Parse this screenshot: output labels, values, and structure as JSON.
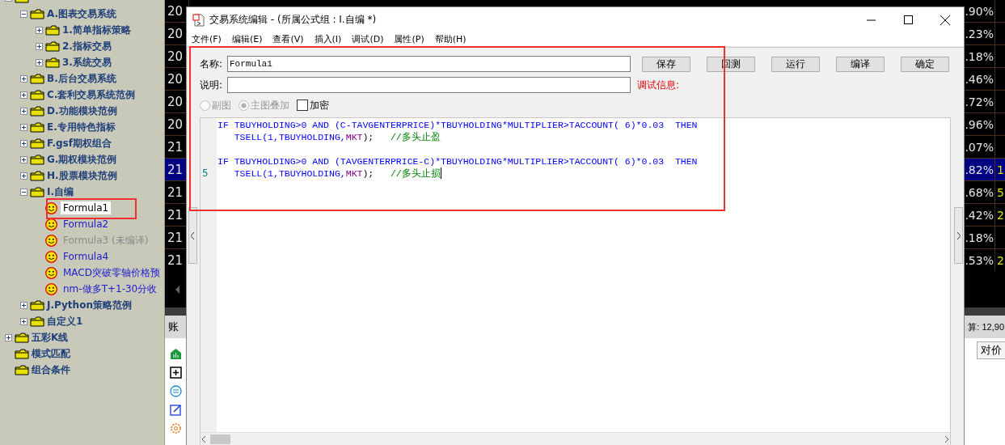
{
  "tree": {
    "items": [
      {
        "kind": "folder",
        "expanded": true,
        "children": [
          {
            "kind": "folder",
            "label": "A.图表交易系统",
            "expanded": true,
            "children": [
              {
                "kind": "folder",
                "label": "1.简单指标策略",
                "expanded": false
              },
              {
                "kind": "folder",
                "label": "2.指标交易",
                "expanded": false
              },
              {
                "kind": "folder",
                "label": "3.系统交易",
                "expanded": false
              }
            ]
          },
          {
            "kind": "folder",
            "label": "B.后台交易系统",
            "expanded": false
          },
          {
            "kind": "folder",
            "label": "C.套利交易系统范例",
            "expanded": false
          },
          {
            "kind": "folder",
            "label": "D.功能模块范例",
            "expanded": false
          },
          {
            "kind": "folder",
            "label": "E.专用特色指标",
            "expanded": false
          },
          {
            "kind": "folder",
            "label": "F.gsf期权组合",
            "expanded": false
          },
          {
            "kind": "folder",
            "label": "G.期权模块范例",
            "expanded": false
          },
          {
            "kind": "folder",
            "label": "H.股票模块范例",
            "expanded": false
          },
          {
            "kind": "folder",
            "label": "I.自编",
            "expanded": true,
            "children": [
              {
                "kind": "formula",
                "label": "Formula1",
                "selected": true,
                "disabled": false
              },
              {
                "kind": "formula",
                "label": "Formula2",
                "selected": false,
                "disabled": false
              },
              {
                "kind": "formula",
                "label": "Formula3 (未编译)",
                "selected": false,
                "disabled": true
              },
              {
                "kind": "formula",
                "label": "Formula4",
                "selected": false,
                "disabled": false
              },
              {
                "kind": "formula",
                "label": "MACD突破零轴价格预",
                "selected": false,
                "disabled": false
              },
              {
                "kind": "formula",
                "label": "nm-做多T+1-30分收",
                "selected": false,
                "disabled": false
              }
            ]
          },
          {
            "kind": "folder",
            "label": "J.Python策略范例",
            "expanded": false
          },
          {
            "kind": "folder",
            "label": "自定义1",
            "expanded": false
          }
        ]
      },
      {
        "kind": "folder",
        "label": "五彩K线",
        "expanded": false
      },
      {
        "kind": "leaf-folder",
        "label": "模式匹配"
      },
      {
        "kind": "leaf-folder",
        "label": "组合条件"
      }
    ]
  },
  "quote_table": {
    "rows": [
      {
        "column_1": "20",
        "column_2": ".90%",
        "selected": false
      },
      {
        "column_1": "20",
        "column_2": ".23%",
        "selected": false
      },
      {
        "column_1": "20",
        "column_2": ".18%",
        "selected": false
      },
      {
        "column_1": "20",
        "column_2": ".46%",
        "selected": false
      },
      {
        "column_1": "20",
        "column_2": ".72%",
        "selected": false
      },
      {
        "column_1": "20",
        "column_2": ".96%",
        "selected": false
      },
      {
        "column_1": "21",
        "column_2": ".07%",
        "selected": false
      },
      {
        "column_1": "21",
        "column_2": ".82%",
        "column_3": "1",
        "selected": true
      },
      {
        "column_1": "21",
        "column_2": ".68%",
        "column_3": "5",
        "selected": false
      },
      {
        "column_1": "21",
        "column_2": ".42%",
        "column_3": "2",
        "selected": false
      },
      {
        "column_1": "21",
        "column_2": ".18%",
        "selected": false
      },
      {
        "column_1": "21",
        "column_2": ".53%",
        "column_3": "2",
        "selected": false
      }
    ]
  },
  "account_panel": {
    "tab": "账",
    "summary": "算: 12,90",
    "button": "对价"
  },
  "dialog": {
    "title": "交易系统编辑 - (所属公式组 : I.自编 *)",
    "menu": [
      "文件(F)",
      "编辑(E)",
      "查看(V)",
      "插入(I)",
      "调试(D)",
      "属性(P)",
      "帮助(H)"
    ],
    "name_label": "名称:",
    "name_value": "Formula1",
    "description_label": "说明:",
    "buttons": [
      "保存",
      "回测",
      "运行",
      "编译",
      "确定"
    ],
    "debug_info": "调试信息:",
    "options": [
      {
        "kind": "radio",
        "label": "副图",
        "checked": false,
        "disabled": true
      },
      {
        "kind": "radio",
        "label": "主图叠加",
        "checked": true,
        "disabled": true
      },
      {
        "kind": "checkbox",
        "label": "加密",
        "checked": false,
        "disabled": false
      }
    ],
    "code_lines": [
      {
        "kind": "code",
        "tokens": [
          {
            "kind": "code",
            "text": "IF TBUYHOLDING>0 AND (C-TAVGENTERPRICE)*TBUYHOLDING*MULTIPLIER>TACCOUNT( 6)*0.03  THEN"
          }
        ]
      },
      {
        "kind": "code",
        "tokens": [
          {
            "kind": "code",
            "text": "   TSELL(1,TBUYHOLDING,"
          },
          {
            "kind": "constant",
            "text": "MKT"
          },
          {
            "kind": "plain",
            "text": ");   "
          },
          {
            "kind": "comment",
            "text": "//多头止盈"
          }
        ]
      },
      {
        "kind": "blank"
      },
      {
        "kind": "code",
        "tokens": [
          {
            "kind": "code",
            "text": "IF TBUYHOLDING>0 AND (TAVGENTERPRICE-C)*TBUYHOLDING*MULTIPLIER>TACCOUNT( 6)*0.03  THEN"
          }
        ]
      },
      {
        "kind": "code",
        "number": "5",
        "cursor": true,
        "tokens": [
          {
            "kind": "code",
            "text": "   TSELL(1,TBUYHOLDING,"
          },
          {
            "kind": "constant",
            "text": "MKT"
          },
          {
            "kind": "plain",
            "text": ");   "
          },
          {
            "kind": "comment",
            "text": "//多头止损"
          }
        ]
      }
    ]
  }
}
